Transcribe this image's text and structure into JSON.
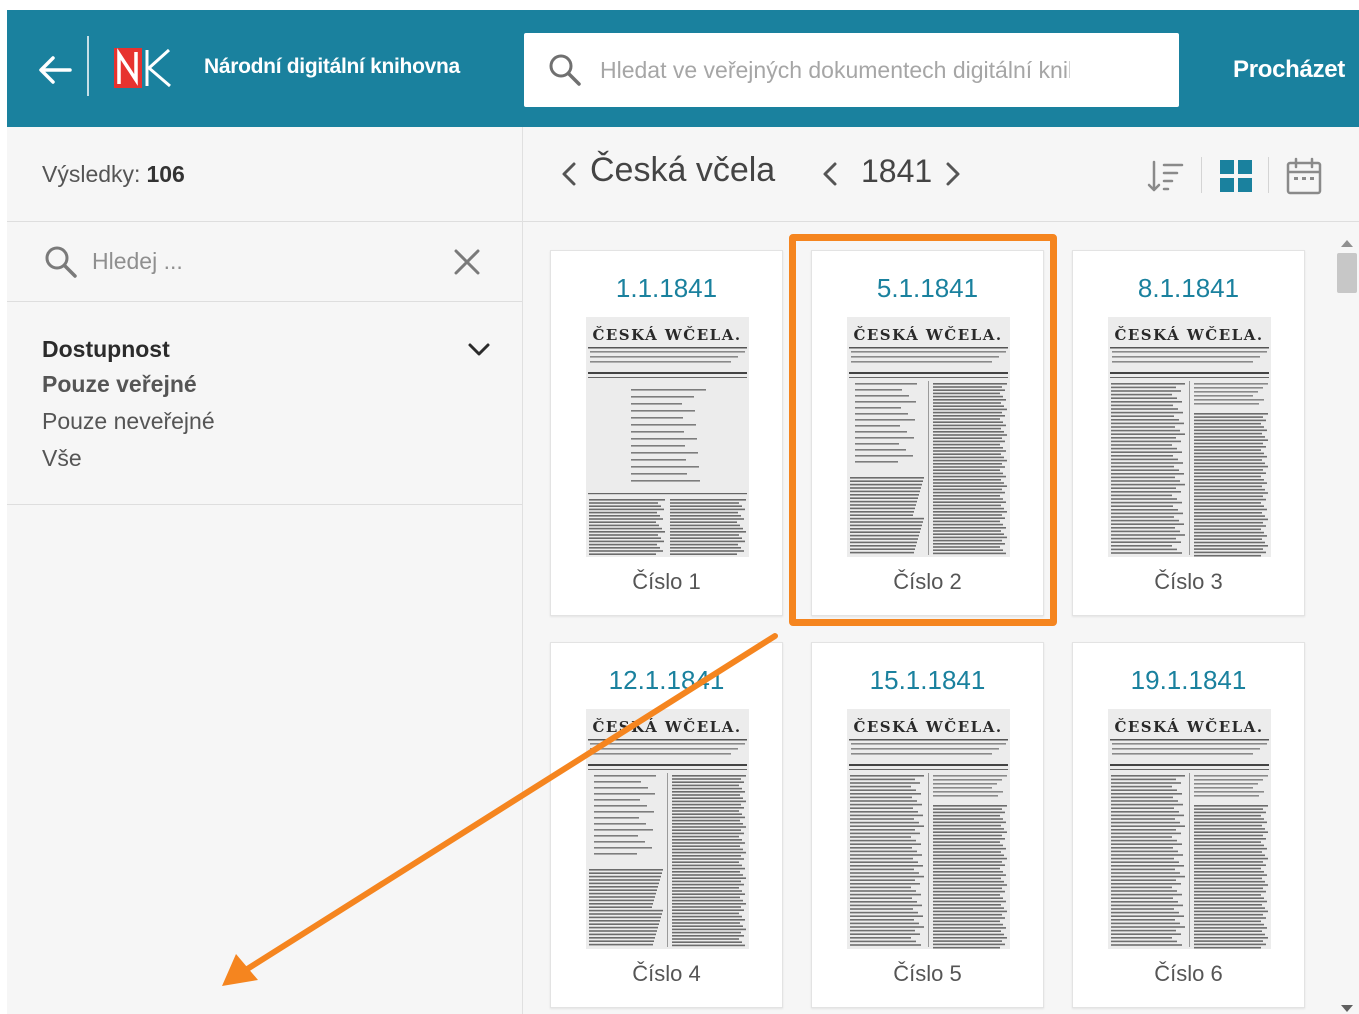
{
  "header": {
    "brand_name": "Národní digitální knihovna",
    "search_placeholder": "Hledat ve veřejných dokumentech digitální knihovny",
    "browse_label": "Procházet",
    "colors": {
      "bar": "#1a819e",
      "logo_red": "#e7322f"
    }
  },
  "sidebar": {
    "results_label": "Výsledky:",
    "results_count": "106",
    "filter_placeholder": "Hledej ...",
    "facet": {
      "title": "Dostupnost",
      "options": [
        {
          "label": "Pouze veřejné",
          "active": true
        },
        {
          "label": "Pouze neveřejné",
          "active": false
        },
        {
          "label": "Vše",
          "active": false
        }
      ]
    }
  },
  "toolbar": {
    "periodical_title": "Česká včela",
    "year": "1841"
  },
  "issues": [
    {
      "date": "1.1.1841",
      "label": "Číslo 1"
    },
    {
      "date": "5.1.1841",
      "label": "Číslo 2"
    },
    {
      "date": "8.1.1841",
      "label": "Číslo 3"
    },
    {
      "date": "12.1.1841",
      "label": "Číslo 4"
    },
    {
      "date": "15.1.1841",
      "label": "Číslo 5"
    },
    {
      "date": "19.1.1841",
      "label": "Číslo 6"
    }
  ],
  "thumbnail_masthead": "ČESKÁ WČELA.",
  "highlight_color": "#f5851f"
}
